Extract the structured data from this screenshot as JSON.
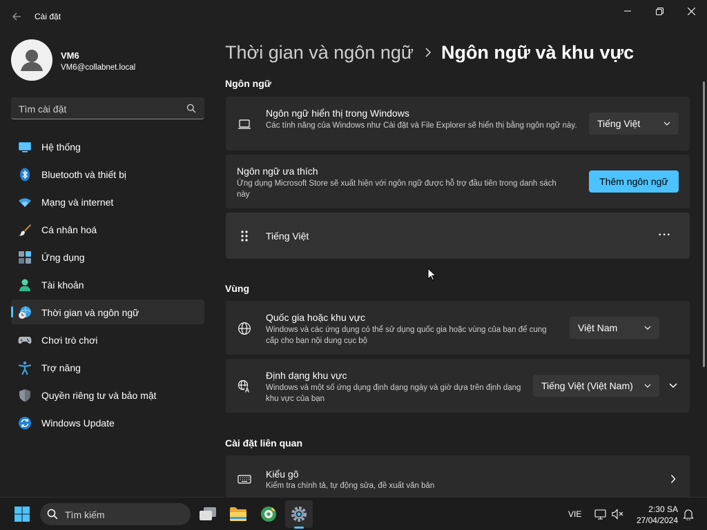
{
  "window": {
    "title": "Cài đặt"
  },
  "profile": {
    "name": "VM6",
    "email": "VM6@collabnet.local"
  },
  "search": {
    "placeholder": "Tìm cài đặt"
  },
  "nav": {
    "items": [
      {
        "label": "Hệ thống",
        "icon": "system-icon"
      },
      {
        "label": "Bluetooth và thiết bị",
        "icon": "bluetooth-icon"
      },
      {
        "label": "Mạng và internet",
        "icon": "wifi-icon"
      },
      {
        "label": "Cá nhân hoá",
        "icon": "brush-icon"
      },
      {
        "label": "Ứng dụng",
        "icon": "apps-icon"
      },
      {
        "label": "Tài khoản",
        "icon": "account-icon"
      },
      {
        "label": "Thời gian và ngôn ngữ",
        "icon": "time-language-icon",
        "active": true
      },
      {
        "label": "Chơi trò chơi",
        "icon": "gamepad-icon"
      },
      {
        "label": "Trợ năng",
        "icon": "accessibility-icon"
      },
      {
        "label": "Quyền riêng tư và bảo mật",
        "icon": "shield-icon"
      },
      {
        "label": "Windows Update",
        "icon": "update-icon"
      }
    ]
  },
  "breadcrumb": {
    "parent": "Thời gian và ngôn ngữ",
    "current": "Ngôn ngữ và khu vực"
  },
  "sections": {
    "language": "Ngôn ngữ",
    "region": "Vùng",
    "related": "Cài đặt liên quan"
  },
  "cards": {
    "display_language": {
      "title": "Ngôn ngữ hiển thị trong Windows",
      "desc": "Các tính năng của Windows như Cài đặt và File Explorer sẽ hiển thị bằng ngôn ngữ này.",
      "value": "Tiếng Việt"
    },
    "preferred_language": {
      "title": "Ngôn ngữ ưa thích",
      "desc": "Ứng dụng Microsoft Store sẽ xuất hiện với ngôn ngữ được hỗ trợ đầu tiên trong danh sách này",
      "button": "Thêm ngôn ngữ"
    },
    "language_item": {
      "title": "Tiếng Việt",
      "more": "···"
    },
    "country": {
      "title": "Quốc gia hoặc khu vực",
      "desc": "Windows và các ứng dụng có thể sử dụng quốc gia hoặc vùng của bạn để cung cấp cho bạn nội dung cục bộ",
      "value": "Việt Nam"
    },
    "regional_format": {
      "title": "Định dạng khu vực",
      "desc": "Windows và một số ứng dụng định dạng ngày và giờ dựa trên định dạng khu vực của bạn",
      "value": "Tiếng Việt (Việt Nam)"
    },
    "typing": {
      "title": "Kiểu gõ",
      "desc": "Kiểm tra chính tả, tự động sửa, đề xuất văn bản"
    }
  },
  "taskbar": {
    "search": "Tìm kiếm",
    "lang": "VIE",
    "time": "2:30 SA",
    "date": "27/04/2024"
  },
  "colors": {
    "accent": "#4cc2ff",
    "background": "#202020",
    "card": "#2b2b2b"
  }
}
